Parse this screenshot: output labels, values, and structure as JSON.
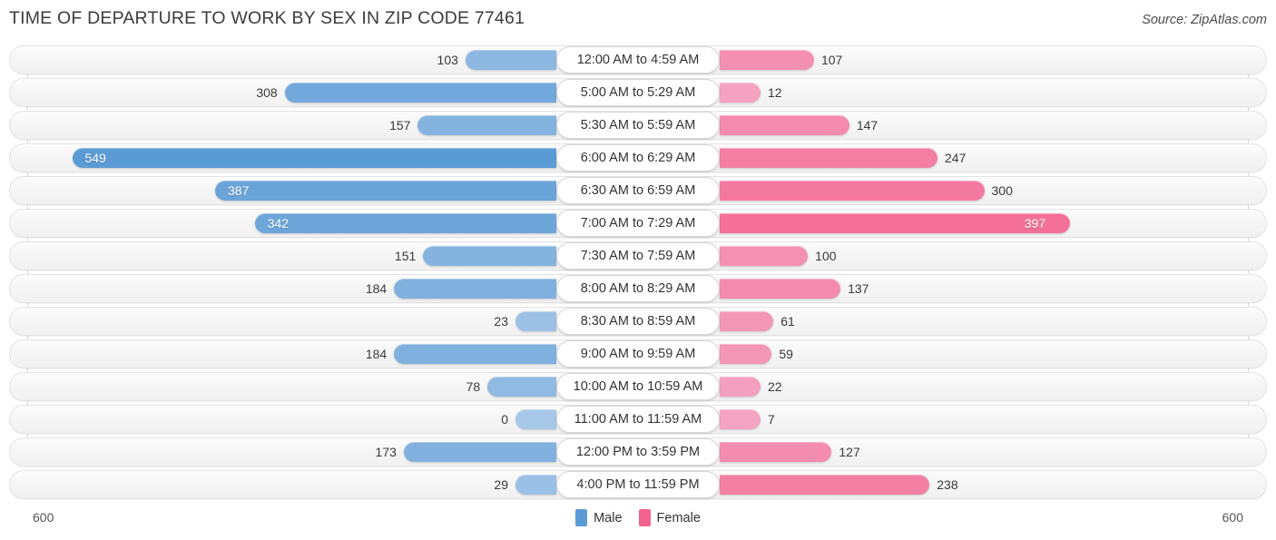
{
  "header": {
    "title": "TIME OF DEPARTURE TO WORK BY SEX IN ZIP CODE 77461",
    "source": "Source: ZipAtlas.com"
  },
  "footer": {
    "axis_left": "600",
    "axis_right": "600",
    "legend": [
      {
        "label": "Male",
        "color": "#5b9bd5"
      },
      {
        "label": "Female",
        "color": "#f4638f"
      }
    ]
  },
  "colors": {
    "male_light": "#a7c7e8",
    "male_dark": "#5b9bd5",
    "female_light": "#f4a8c4",
    "female_dark": "#f4638f",
    "track": "#f5f5f5",
    "gridline": "#d8d8d8"
  },
  "chart_data": {
    "type": "bar",
    "title": "TIME OF DEPARTURE TO WORK BY SEX IN ZIP CODE 77461",
    "subtitle": "",
    "xlabel": "",
    "ylabel": "",
    "orientation": "horizontal-diverging",
    "axis_max": 600,
    "xlim": [
      600,
      600
    ],
    "grid": true,
    "legend_position": "bottom-center",
    "categories": [
      "12:00 AM to 4:59 AM",
      "5:00 AM to 5:29 AM",
      "5:30 AM to 5:59 AM",
      "6:00 AM to 6:29 AM",
      "6:30 AM to 6:59 AM",
      "7:00 AM to 7:29 AM",
      "7:30 AM to 7:59 AM",
      "8:00 AM to 8:29 AM",
      "8:30 AM to 8:59 AM",
      "9:00 AM to 9:59 AM",
      "10:00 AM to 10:59 AM",
      "11:00 AM to 11:59 AM",
      "12:00 PM to 3:59 PM",
      "4:00 PM to 11:59 PM"
    ],
    "series": [
      {
        "name": "Male",
        "color": "#5b9bd5",
        "values": [
          103,
          308,
          157,
          549,
          387,
          342,
          151,
          184,
          23,
          184,
          78,
          0,
          173,
          29
        ]
      },
      {
        "name": "Female",
        "color": "#f4638f",
        "values": [
          107,
          12,
          147,
          247,
          300,
          397,
          100,
          137,
          61,
          59,
          22,
          7,
          127,
          238
        ]
      }
    ]
  }
}
